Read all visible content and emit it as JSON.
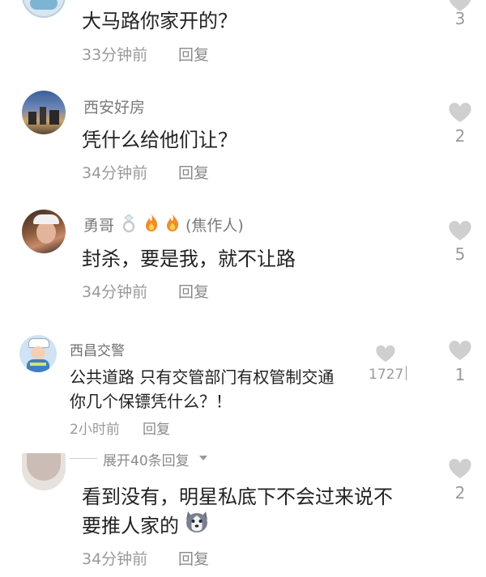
{
  "colors": {
    "text": "#222222",
    "meta": "#9a9a9a",
    "heart": "#cfcfcf",
    "background": "#ffffff"
  },
  "comments": [
    {
      "username": "",
      "text_lines": [
        "大马路你家开的？"
      ],
      "time": "33分钟前",
      "reply_label": "回复",
      "likes": "3"
    },
    {
      "username": "西安好房",
      "text_lines": [
        "凭什么给他们让？"
      ],
      "time": "34分钟前",
      "reply_label": "回复",
      "likes": "2"
    },
    {
      "username": "勇哥",
      "username_suffix": "(焦作人)",
      "badges": [
        "ring-icon",
        "fire-icon",
        "fire-icon"
      ],
      "text_lines": [
        "封杀，要是我，就不让路"
      ],
      "time": "34分钟前",
      "reply_label": "回复",
      "likes": "5"
    },
    {
      "username": "西昌交警",
      "text_lines": [
        "公共道路 只有交管部门有权管制交通",
        "你几个保镖凭什么？！"
      ],
      "time": "2小时前",
      "reply_label": "回复",
      "likes": "1727",
      "outer_likes": "1"
    },
    {
      "username": "",
      "text_lines": [
        "看到没有，明星私底下不会过来说不",
        "要推人家的"
      ],
      "emoji": "husky-dog-emoji",
      "time": "34分钟前",
      "reply_label": "回复",
      "likes": "2"
    }
  ],
  "expand_replies": {
    "label": "展开40条回复"
  }
}
